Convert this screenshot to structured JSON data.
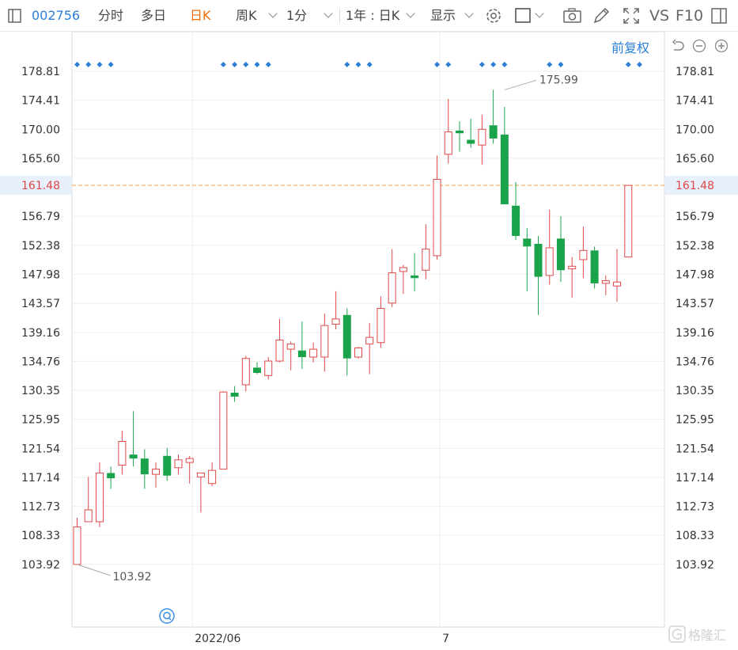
{
  "toolbar": {
    "code": "002756",
    "items": [
      {
        "label": "分时"
      },
      {
        "label": "多日"
      },
      {
        "label": "日K",
        "active": true
      },
      {
        "label": "周K"
      },
      {
        "label": "1分"
      },
      {
        "label": "1年 : 日K"
      },
      {
        "label": "显示"
      }
    ],
    "icons": [
      "settings-icon",
      "square-icon",
      "camera-icon",
      "pen-icon",
      "fullscreen-icon"
    ],
    "vs_label": "VS",
    "f10_label": "F10",
    "restore_label": "前复权"
  },
  "chart_data": {
    "type": "candlestick",
    "y_ticks": [
      "178.81",
      "174.41",
      "170.00",
      "165.60",
      "161.48",
      "156.79",
      "152.38",
      "147.98",
      "143.57",
      "139.16",
      "134.76",
      "130.35",
      "125.95",
      "121.54",
      "117.14",
      "112.73",
      "108.33",
      "103.92"
    ],
    "current_price": "161.48",
    "x_labels": [
      {
        "label": "2022/06",
        "index": 11
      },
      {
        "label": "7",
        "index": 33
      }
    ],
    "high_label": {
      "label": "175.99",
      "index": 38
    },
    "low_label": {
      "label": "103.92",
      "index": 0
    },
    "up_color": "#e04848",
    "down_color": "#1aa34a",
    "marker_color": "#2b7fd9",
    "marker_indices": [
      0,
      1,
      2,
      3,
      13,
      14,
      15,
      16,
      17,
      24,
      25,
      26,
      32,
      33,
      36,
      37,
      38,
      42,
      43,
      49,
      50
    ],
    "candles": [
      {
        "o": 103.92,
        "h": 111.0,
        "l": 103.92,
        "c": 109.6
      },
      {
        "o": 110.4,
        "h": 117.2,
        "l": 110.4,
        "c": 112.2
      },
      {
        "o": 110.4,
        "h": 119.4,
        "l": 109.6,
        "c": 117.8
      },
      {
        "o": 117.8,
        "h": 118.8,
        "l": 115.4,
        "c": 117.0
      },
      {
        "o": 119.0,
        "h": 124.2,
        "l": 117.6,
        "c": 122.6
      },
      {
        "o": 120.6,
        "h": 127.2,
        "l": 118.8,
        "c": 120.0
      },
      {
        "o": 120.0,
        "h": 121.4,
        "l": 115.4,
        "c": 117.6
      },
      {
        "o": 117.6,
        "h": 119.4,
        "l": 115.6,
        "c": 118.4
      },
      {
        "o": 120.4,
        "h": 121.6,
        "l": 116.6,
        "c": 117.4
      },
      {
        "o": 118.6,
        "h": 120.6,
        "l": 117.6,
        "c": 119.8
      },
      {
        "o": 119.4,
        "h": 120.4,
        "l": 116.2,
        "c": 120.0
      },
      {
        "o": 117.2,
        "h": 117.8,
        "l": 111.8,
        "c": 117.8
      },
      {
        "o": 116.2,
        "h": 119.4,
        "l": 115.8,
        "c": 118.2
      },
      {
        "o": 118.4,
        "h": 130.2,
        "l": 118.4,
        "c": 130.1
      },
      {
        "o": 130.0,
        "h": 131.0,
        "l": 128.6,
        "c": 129.4
      },
      {
        "o": 131.2,
        "h": 135.6,
        "l": 130.2,
        "c": 135.2
      },
      {
        "o": 133.8,
        "h": 134.6,
        "l": 132.8,
        "c": 133.0
      },
      {
        "o": 132.6,
        "h": 135.4,
        "l": 132.0,
        "c": 134.8
      },
      {
        "o": 134.8,
        "h": 141.2,
        "l": 134.6,
        "c": 138.0
      },
      {
        "o": 136.6,
        "h": 137.8,
        "l": 133.4,
        "c": 137.4
      },
      {
        "o": 136.4,
        "h": 140.8,
        "l": 133.6,
        "c": 135.4
      },
      {
        "o": 135.4,
        "h": 137.6,
        "l": 134.6,
        "c": 136.6
      },
      {
        "o": 135.4,
        "h": 142.0,
        "l": 133.2,
        "c": 140.2
      },
      {
        "o": 140.4,
        "h": 145.4,
        "l": 139.6,
        "c": 141.2
      },
      {
        "o": 141.8,
        "h": 142.8,
        "l": 132.6,
        "c": 135.2
      },
      {
        "o": 135.4,
        "h": 137.0,
        "l": 135.2,
        "c": 136.8
      },
      {
        "o": 137.4,
        "h": 140.6,
        "l": 132.8,
        "c": 138.4
      },
      {
        "o": 137.6,
        "h": 144.6,
        "l": 136.8,
        "c": 142.8
      },
      {
        "o": 143.6,
        "h": 151.8,
        "l": 143.0,
        "c": 148.2
      },
      {
        "o": 148.4,
        "h": 149.4,
        "l": 145.0,
        "c": 149.0
      },
      {
        "o": 147.8,
        "h": 151.2,
        "l": 145.4,
        "c": 147.4
      },
      {
        "o": 148.6,
        "h": 155.6,
        "l": 147.2,
        "c": 151.8
      },
      {
        "o": 150.8,
        "h": 166.0,
        "l": 150.2,
        "c": 162.4
      },
      {
        "o": 166.2,
        "h": 174.6,
        "l": 164.8,
        "c": 169.6
      },
      {
        "o": 169.8,
        "h": 171.2,
        "l": 166.6,
        "c": 169.4
      },
      {
        "o": 168.4,
        "h": 171.6,
        "l": 167.2,
        "c": 167.8
      },
      {
        "o": 167.6,
        "h": 172.2,
        "l": 164.6,
        "c": 170.0
      },
      {
        "o": 170.6,
        "h": 175.99,
        "l": 167.8,
        "c": 168.6
      },
      {
        "o": 169.2,
        "h": 173.4,
        "l": 166.2,
        "c": 158.6
      },
      {
        "o": 158.4,
        "h": 162.0,
        "l": 153.2,
        "c": 153.8
      },
      {
        "o": 153.4,
        "h": 155.0,
        "l": 145.4,
        "c": 152.2
      },
      {
        "o": 152.6,
        "h": 153.8,
        "l": 141.8,
        "c": 147.6
      },
      {
        "o": 147.8,
        "h": 157.8,
        "l": 146.4,
        "c": 152.0
      },
      {
        "o": 153.4,
        "h": 156.8,
        "l": 146.8,
        "c": 148.6
      },
      {
        "o": 148.8,
        "h": 150.6,
        "l": 144.4,
        "c": 149.2
      },
      {
        "o": 150.2,
        "h": 155.2,
        "l": 147.4,
        "c": 151.6
      },
      {
        "o": 151.6,
        "h": 152.2,
        "l": 145.8,
        "c": 146.6
      },
      {
        "o": 146.6,
        "h": 147.8,
        "l": 144.8,
        "c": 147.0
      },
      {
        "o": 146.2,
        "h": 151.8,
        "l": 143.8,
        "c": 146.8
      },
      {
        "o": 150.6,
        "h": 161.48,
        "l": 150.6,
        "c": 161.48
      }
    ]
  },
  "watermark": "格隆汇"
}
